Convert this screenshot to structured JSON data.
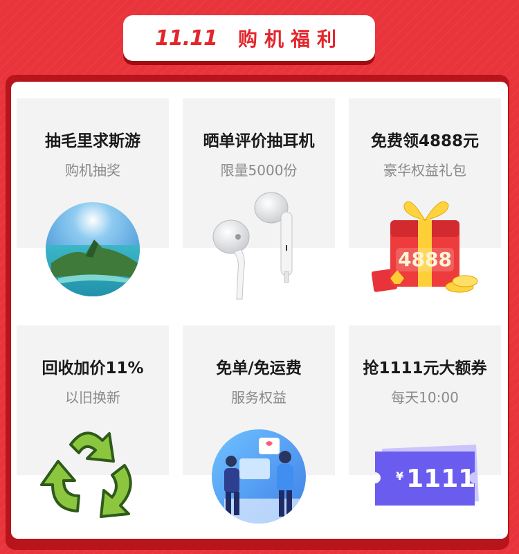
{
  "header": {
    "num": "11.11",
    "title": "购机福利"
  },
  "cards": [
    {
      "title": "抽毛里求斯游",
      "subtitle": "购机抽奖",
      "icon": "island-photo-icon"
    },
    {
      "title": "晒单评价抽耳机",
      "subtitle": "限量5000份",
      "icon": "earphones-icon"
    },
    {
      "title": "免费领4888元",
      "subtitle": "豪华权益礼包",
      "icon": "gift-box-icon",
      "badge": "4888"
    },
    {
      "title": "回收加价11%",
      "subtitle": "以旧换新",
      "icon": "recycle-icon"
    },
    {
      "title": "免单/免运费",
      "subtitle": "服务权益",
      "icon": "service-people-icon"
    },
    {
      "title": "抢1111元大额券",
      "subtitle": "每天10:00",
      "icon": "coupon-icon",
      "badge": "¥1111"
    }
  ],
  "colors": {
    "brand_red": "#e3262d",
    "coupon_purple": "#6b5cf0"
  }
}
